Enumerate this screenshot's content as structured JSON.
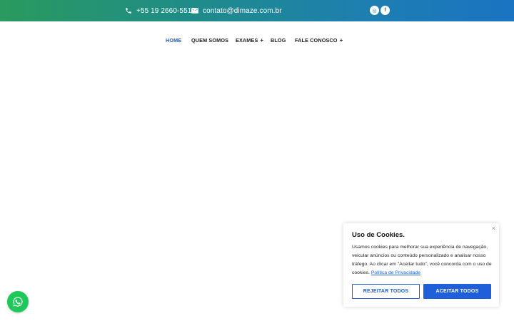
{
  "topbar": {
    "phone": "+55 19 2660-5519",
    "email": "contato@dimaze.com.br",
    "social": [
      {
        "name": "instagram-icon",
        "glyph": "◎"
      },
      {
        "name": "facebook-icon",
        "glyph": "f"
      }
    ]
  },
  "nav": {
    "items": [
      {
        "label": "HOME",
        "active": true
      },
      {
        "label": "QUEM SOMOS"
      },
      {
        "label": "EXAMES",
        "plus": "+"
      },
      {
        "label": "BLOG"
      },
      {
        "label": "FALE CONOSCO",
        "plus": "+"
      }
    ]
  },
  "cookie": {
    "title": "Uso de Cookies.",
    "text": "Usamos cookies para melhorar sua experiência de navegação, veicular anúncios ou conteúdo personalizado e analisar nosso tráfego. Ao clicar em \"Aceitar tudo\", você concorda com o uso de cookies.",
    "link": "Política de Privacidade",
    "close": "×",
    "reject_label": "REJEITAR TODOS",
    "accept_label": "ACEITAR TODOS"
  },
  "colors": {
    "accent": "#1f5fd9",
    "whatsapp": "#1fc85a",
    "nav_active": "#2b5aa8"
  }
}
